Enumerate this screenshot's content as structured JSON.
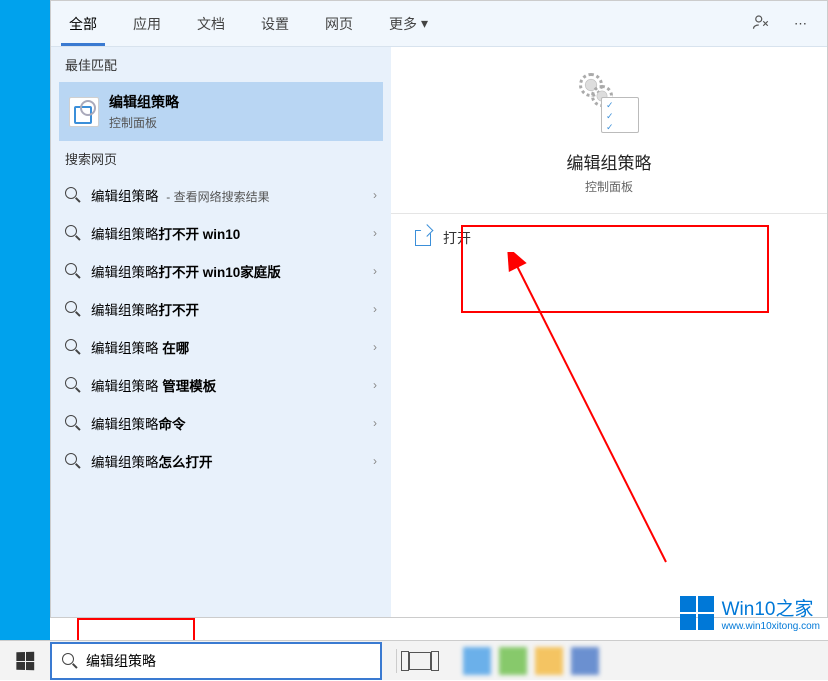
{
  "tabs": {
    "all": "全部",
    "apps": "应用",
    "documents": "文档",
    "settings": "设置",
    "web": "网页",
    "more": "更多"
  },
  "sections": {
    "best_match": "最佳匹配",
    "web_search": "搜索网页"
  },
  "best_match": {
    "title": "编辑组策略",
    "subtitle": "控制面板"
  },
  "web_results": [
    {
      "prefix": "编辑组策略",
      "bold": "",
      "suffix": "查看网络搜索结果"
    },
    {
      "prefix": "编辑组策略",
      "bold": "打不开 win10",
      "suffix": ""
    },
    {
      "prefix": "编辑组策略",
      "bold": "打不开 win10家庭版",
      "suffix": ""
    },
    {
      "prefix": "编辑组策略",
      "bold": "打不开",
      "suffix": ""
    },
    {
      "prefix": "编辑组策略",
      "bold": " 在哪",
      "suffix": ""
    },
    {
      "prefix": "编辑组策略",
      "bold": " 管理模板",
      "suffix": ""
    },
    {
      "prefix": "编辑组策略",
      "bold": "命令",
      "suffix": ""
    },
    {
      "prefix": "编辑组策略",
      "bold": "怎么打开",
      "suffix": ""
    }
  ],
  "detail": {
    "title": "编辑组策略",
    "subtitle": "控制面板",
    "open_label": "打开"
  },
  "search": {
    "value": "编辑组策略"
  },
  "watermark": {
    "brand": "Win10之家",
    "url": "www.win10xitong.com"
  }
}
